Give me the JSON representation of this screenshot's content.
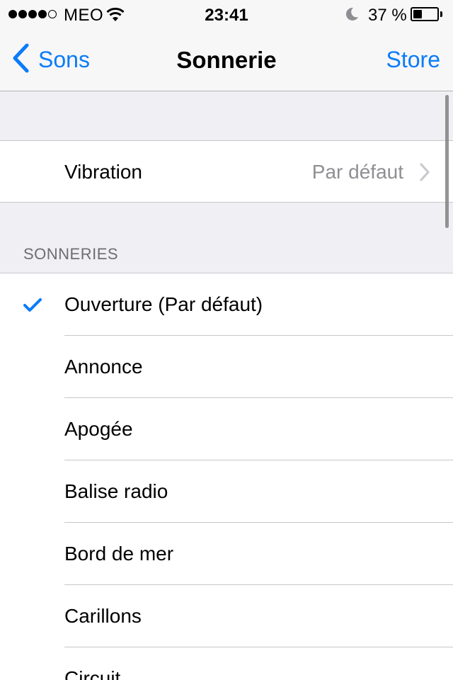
{
  "status_bar": {
    "carrier": "MEO",
    "time": "23:41",
    "battery_percent": "37 %",
    "battery_level": 0.37,
    "signal_bars_filled": 4,
    "signal_bars_total": 5,
    "icons": [
      "signal-dots-icon",
      "wifi-icon",
      "moon-icon",
      "battery-icon"
    ]
  },
  "nav": {
    "back_label": "Sons",
    "title": "Sonnerie",
    "right_label": "Store",
    "accent_color": "#0b7cf8"
  },
  "vibration": {
    "label": "Vibration",
    "value": "Par défaut"
  },
  "ringtones": {
    "section_title": "SONNERIES",
    "selected_index": 0,
    "items": [
      {
        "label": "Ouverture (Par défaut)"
      },
      {
        "label": "Annonce"
      },
      {
        "label": "Apogée"
      },
      {
        "label": "Balise radio"
      },
      {
        "label": "Bord de mer"
      },
      {
        "label": "Carillons"
      },
      {
        "label": "Circuit"
      }
    ]
  }
}
